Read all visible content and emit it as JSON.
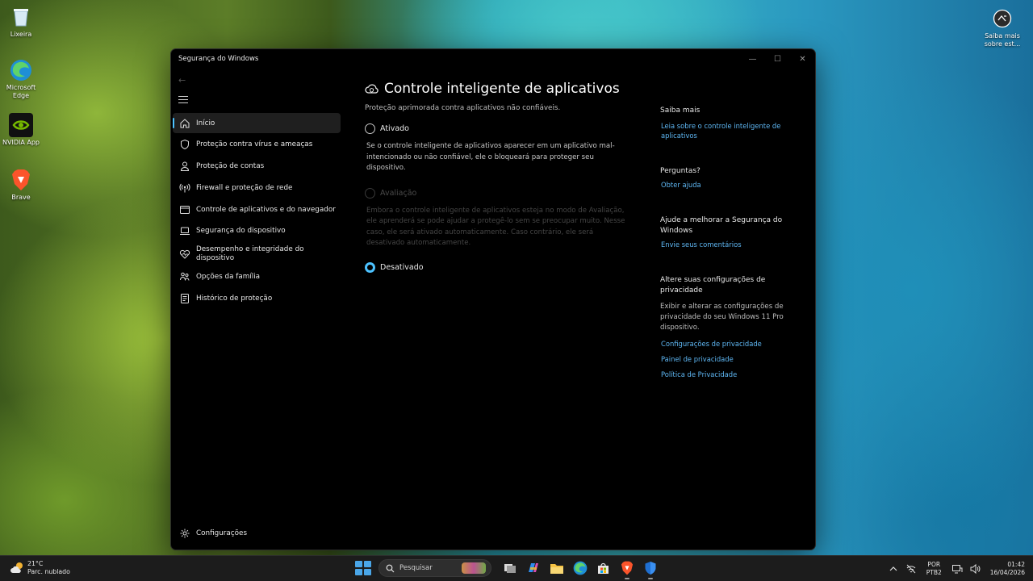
{
  "desktop": {
    "icons": [
      {
        "label": "Lixeira",
        "icon": "recycle-bin-icon"
      },
      {
        "label": "Microsoft Edge",
        "icon": "edge-icon"
      },
      {
        "label": "NVIDIA App",
        "icon": "nvidia-icon"
      },
      {
        "label": "Brave",
        "icon": "brave-icon"
      }
    ],
    "right_icon": {
      "label": "Saiba mais sobre est...",
      "icon": "camera-info-icon"
    }
  },
  "window": {
    "title": "Segurança do Windows",
    "controls": {
      "minimize": "—",
      "maximize": "☐",
      "close": "✕"
    }
  },
  "sidebar": {
    "back": "←",
    "items": [
      {
        "label": "Início",
        "icon": "home-icon",
        "active": true
      },
      {
        "label": "Proteção contra vírus e ameaças",
        "icon": "shield-icon"
      },
      {
        "label": "Proteção de contas",
        "icon": "person-icon"
      },
      {
        "label": "Firewall e proteção de rede",
        "icon": "antenna-icon"
      },
      {
        "label": "Controle de aplicativos e do navegador",
        "icon": "app-browser-icon"
      },
      {
        "label": "Segurança do dispositivo",
        "icon": "laptop-icon"
      },
      {
        "label": "Desempenho e integridade do dispositivo",
        "icon": "heart-icon"
      },
      {
        "label": "Opções da família",
        "icon": "family-icon"
      },
      {
        "label": "Histórico de proteção",
        "icon": "history-icon"
      }
    ],
    "settings": {
      "label": "Configurações",
      "icon": "gear-icon"
    }
  },
  "main": {
    "title": "Controle inteligente de aplicativos",
    "subtitle": "Proteção aprimorada contra aplicativos não confiáveis.",
    "options": [
      {
        "label": "Ativado",
        "state": "unchecked",
        "description": "Se o controle inteligente de aplicativos aparecer em um aplicativo mal-intencionado ou não confiável, ele o bloqueará para proteger seu dispositivo."
      },
      {
        "label": "Avaliação",
        "state": "disabled",
        "description": "Embora o controle inteligente de aplicativos esteja no modo de Avaliação, ele aprenderá se pode ajudar a protegê-lo sem se preocupar muito. Nesse caso, ele será ativado automaticamente. Caso contrário, ele será desativado automaticamente."
      },
      {
        "label": "Desativado",
        "state": "checked"
      }
    ]
  },
  "aside": {
    "learn_more": {
      "heading": "Saiba mais",
      "link": "Leia sobre o controle inteligente de aplicativos"
    },
    "questions": {
      "heading": "Perguntas?",
      "link": "Obter ajuda"
    },
    "improve": {
      "heading": "Ajude a melhorar a Segurança do Windows",
      "link": "Envie seus comentários"
    },
    "privacy": {
      "heading": "Altere suas configurações de privacidade",
      "text": "Exibir e alterar as configurações de privacidade do seu Windows 11 Pro dispositivo.",
      "links": [
        "Configurações de privacidade",
        "Painel de privacidade",
        "Política de Privacidade"
      ]
    }
  },
  "taskbar": {
    "weather": {
      "temp": "21°C",
      "condition": "Parc. nublado"
    },
    "search_placeholder": "Pesquisar",
    "apps": [
      "task-view-icon",
      "copilot-icon",
      "file-explorer-icon",
      "edge-icon",
      "store-icon",
      "brave-icon",
      "defender-icon"
    ],
    "lang": {
      "line1": "POR",
      "line2": "PTB2"
    },
    "time": "01:42",
    "date": "16/04/2026"
  },
  "colors": {
    "accent": "#4cc2ff",
    "link": "#5eb6f2",
    "window_bg": "#000000",
    "taskbar_bg": "#1c1c1c"
  }
}
